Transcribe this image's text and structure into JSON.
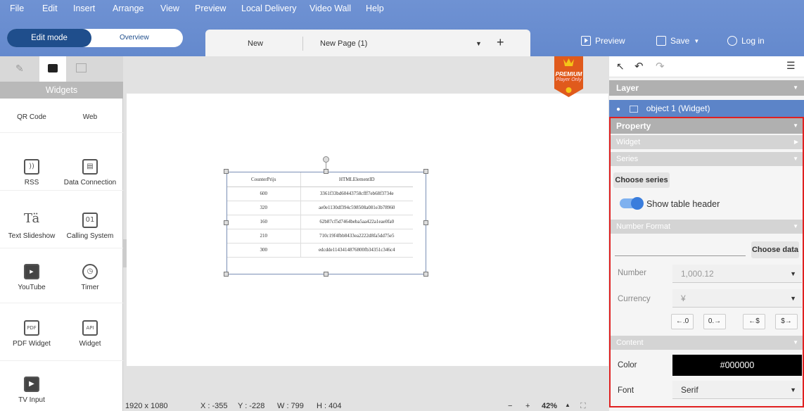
{
  "menu": [
    "File",
    "Edit",
    "Insert",
    "Arrange",
    "View",
    "Preview",
    "Local Delivery",
    "Video Wall",
    "Help"
  ],
  "mode": {
    "edit": "Edit mode",
    "overview": "Overview"
  },
  "tabs": {
    "tab1": "New",
    "tab2": "New Page (1)"
  },
  "header": {
    "preview": "Preview",
    "save": "Save",
    "login": "Log in"
  },
  "left_panel": {
    "title": "Widgets",
    "items": [
      {
        "label": "QR Code",
        "icon": "qr-code-icon"
      },
      {
        "label": "Web",
        "icon": "web-icon"
      },
      {
        "label": "RSS",
        "icon": "rss-icon"
      },
      {
        "label": "Data Connection",
        "icon": "data-connection-icon"
      },
      {
        "label": "Text Slideshow",
        "icon": "text-slideshow-icon"
      },
      {
        "label": "Calling System",
        "icon": "calling-system-icon"
      },
      {
        "label": "YouTube",
        "icon": "youtube-icon"
      },
      {
        "label": "Timer",
        "icon": "timer-icon"
      },
      {
        "label": "PDF Widget",
        "icon": "pdf-icon"
      },
      {
        "label": "Widget",
        "icon": "api-icon"
      },
      {
        "label": "TV Input",
        "icon": "tv-input-icon"
      }
    ]
  },
  "premium": {
    "line1": "PREMIUM",
    "line2": "Player Only"
  },
  "table_widget": {
    "headers": [
      "CounterPrijs",
      "HTMLElementID"
    ],
    "rows": [
      [
        "600",
        "3361f33bd60443758cfff7eb68f3734e"
      ],
      [
        "320",
        "ae0e1130df394c598508a081e3b78960"
      ],
      [
        "160",
        "62b87cf5d7464beba5aa422a1eae0fa0"
      ],
      [
        "210",
        "710c19f4fbb8433ea2222d8fa5dd75e5"
      ],
      [
        "300",
        "edcdde1143414876800fb34351c346c4"
      ]
    ]
  },
  "status": {
    "resolution": "1920 x 1080",
    "x": "X : -355",
    "y": "Y : -228",
    "w": "W : 799",
    "h": "H : 404",
    "minus": "−",
    "plus": "+",
    "zoom": "42%"
  },
  "right_panel": {
    "layer_title": "Layer",
    "layer_item": "object 1 (Widget)",
    "property_title": "Property",
    "widget_label": "Widget",
    "series_label": "Series",
    "choose_series": "Choose series",
    "show_header": "Show table header",
    "number_format": "Number Format",
    "choose_data": "Choose data",
    "number_label": "Number",
    "number_value": "1,000.12",
    "currency_label": "Currency",
    "currency_value": "¥",
    "fmt_buttons": [
      "←.0",
      "0.→",
      "←$",
      "$→"
    ],
    "content_label": "Content",
    "color_label": "Color",
    "color_value": "#000000",
    "font_label": "Font",
    "font_value": "Serif"
  },
  "colors": {
    "header": "#6b8fd0",
    "edit_mode": "#1f4e8c",
    "layer_row": "#5c84c8",
    "toggle": "#3a7ddc",
    "highlight": "#e02020"
  }
}
